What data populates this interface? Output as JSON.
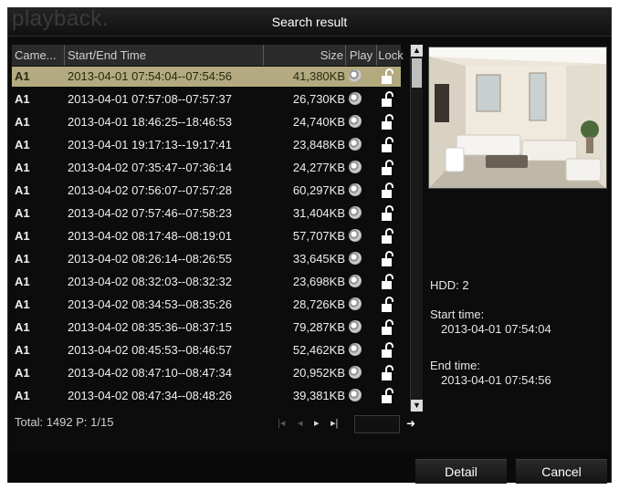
{
  "window": {
    "title": "Search result",
    "ghost_title": "playback."
  },
  "table": {
    "columns": {
      "camera": "Came...",
      "time": "Start/End Time",
      "size": "Size",
      "play": "Play",
      "lock": "Lock"
    },
    "rows": [
      {
        "camera": "A1",
        "time": "2013-04-01 07:54:04--07:54:56",
        "size": "41,380KB",
        "selected": true
      },
      {
        "camera": "A1",
        "time": "2013-04-01 07:57:08--07:57:37",
        "size": "26,730KB"
      },
      {
        "camera": "A1",
        "time": "2013-04-01 18:46:25--18:46:53",
        "size": "24,740KB"
      },
      {
        "camera": "A1",
        "time": "2013-04-01 19:17:13--19:17:41",
        "size": "23,848KB"
      },
      {
        "camera": "A1",
        "time": "2013-04-02 07:35:47--07:36:14",
        "size": "24,277KB"
      },
      {
        "camera": "A1",
        "time": "2013-04-02 07:56:07--07:57:28",
        "size": "60,297KB"
      },
      {
        "camera": "A1",
        "time": "2013-04-02 07:57:46--07:58:23",
        "size": "31,404KB"
      },
      {
        "camera": "A1",
        "time": "2013-04-02 08:17:48--08:19:01",
        "size": "57,707KB"
      },
      {
        "camera": "A1",
        "time": "2013-04-02 08:26:14--08:26:55",
        "size": "33,645KB"
      },
      {
        "camera": "A1",
        "time": "2013-04-02 08:32:03--08:32:32",
        "size": "23,698KB"
      },
      {
        "camera": "A1",
        "time": "2013-04-02 08:34:53--08:35:26",
        "size": "28,726KB"
      },
      {
        "camera": "A1",
        "time": "2013-04-02 08:35:36--08:37:15",
        "size": "79,287KB"
      },
      {
        "camera": "A1",
        "time": "2013-04-02 08:45:53--08:46:57",
        "size": "52,462KB"
      },
      {
        "camera": "A1",
        "time": "2013-04-02 08:47:10--08:47:34",
        "size": "20,952KB"
      },
      {
        "camera": "A1",
        "time": "2013-04-02 08:47:34--08:48:26",
        "size": "39,381KB"
      }
    ],
    "play_icon": "play-disc-icon",
    "lock_icon": "unlocked-padlock-icon"
  },
  "footer": {
    "total_label": "Total:",
    "total": "1492",
    "page_label": "P:",
    "page": "1/15",
    "go_icon": "arrow-right-icon"
  },
  "info": {
    "hdd": "HDD: 2",
    "start_label": "Start time:",
    "start_value": "2013-04-01 07:54:04",
    "end_label": "End time:",
    "end_value": "2013-04-01 07:54:56"
  },
  "buttons": {
    "detail": "Detail",
    "cancel": "Cancel"
  },
  "colors": {
    "selected_row": "#b3ab7f",
    "background": "#0c0c0c"
  }
}
